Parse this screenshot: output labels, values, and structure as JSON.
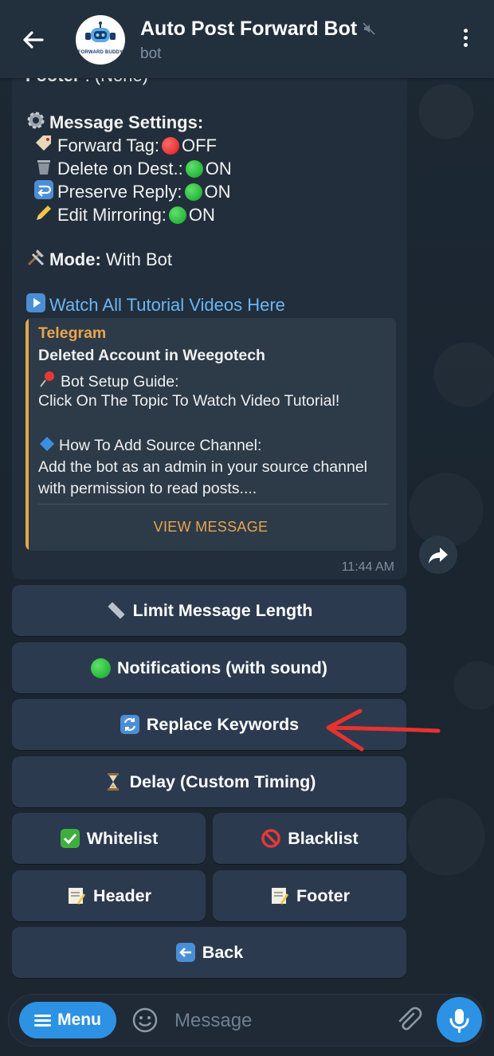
{
  "header": {
    "title": "Auto Post Forward Bot",
    "subtitle": "bot",
    "avatar_text": "FORWARD BUDDY",
    "muted": true
  },
  "message": {
    "footer_line_label": "Footer",
    "footer_line_value": " : (None)",
    "settings_title": "Message Settings:",
    "forward_tag_label": "Forward Tag:",
    "forward_tag_value": "OFF",
    "delete_label": "Delete on Dest.:",
    "delete_value": "ON",
    "preserve_label": "Preserve Reply:",
    "preserve_value": "ON",
    "edit_label": "Edit Mirroring:",
    "edit_value": "ON",
    "mode_label": "Mode:",
    "mode_value": "With Bot",
    "tutorial_link": "Watch All Tutorial Videos Here",
    "time": "11:44 AM",
    "colors": {
      "on": "#12a528",
      "off": "#d91b1b",
      "link": "#6ab7f5"
    }
  },
  "preview": {
    "site": "Telegram",
    "title": "Deleted Account in Weegotech",
    "line1": "Bot Setup Guide:",
    "line2": "Click On The Topic To Watch Video Tutorial!",
    "line3": "How To Add Source Channel:",
    "line4": "Add the bot as an admin in your source channel",
    "line5": "with permission to read posts....",
    "button": "VIEW MESSAGE",
    "accent": "#e8a54e"
  },
  "keyboard": {
    "limit": "Limit Message Length",
    "notifications": "Notifications (with sound)",
    "replace": "Replace Keywords",
    "delay": "Delay (Custom Timing)",
    "whitelist": "Whitelist",
    "blacklist": "Blacklist",
    "header": "Header",
    "footer": "Footer",
    "back": "Back"
  },
  "input": {
    "menu_label": "Menu",
    "placeholder": "Message"
  },
  "icons": {
    "back": "arrow-left-icon",
    "more": "kebab-icon",
    "share": "share-icon",
    "emoji": "smiley-icon",
    "attach": "paperclip-icon",
    "mic": "microphone-icon"
  }
}
